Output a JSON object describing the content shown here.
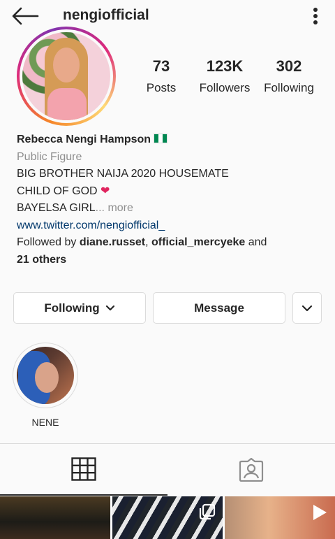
{
  "header": {
    "username": "nengiofficial",
    "back_icon": "arrow-left-icon",
    "more_icon": "vertical-dots-icon"
  },
  "profile": {
    "avatar_icon": "profile-photo",
    "stats": [
      {
        "count": "73",
        "label": "Posts"
      },
      {
        "count": "123K",
        "label": "Followers"
      },
      {
        "count": "302",
        "label": "Following"
      }
    ]
  },
  "bio": {
    "name": "Rebecca Nengi Hampson",
    "category": "Public Figure",
    "line1": "BIG BROTHER NAIJA 2020 HOUSEMATE",
    "line2": "CHILD OF GOD",
    "line3": "BAYELSA GIRL",
    "more": "... more",
    "link": "www.twitter.com/nengiofficial_",
    "followed_by_prefix": "Followed by ",
    "followed_by_user1": "diane.russet",
    "followed_by_sep": ", ",
    "followed_by_user2": "official_mercyeke",
    "followed_by_and": " and",
    "followed_by_others": "21 others"
  },
  "actions": {
    "following_label": "Following",
    "message_label": "Message"
  },
  "highlights": [
    {
      "label": "NENE"
    }
  ],
  "tabs": {
    "grid_icon": "grid-icon",
    "tagged_icon": "tagged-person-icon"
  },
  "colors": {
    "link": "#00376b",
    "secondary_text": "#8e8e8e",
    "border": "#dbdbdb",
    "primary_text": "#262626"
  }
}
